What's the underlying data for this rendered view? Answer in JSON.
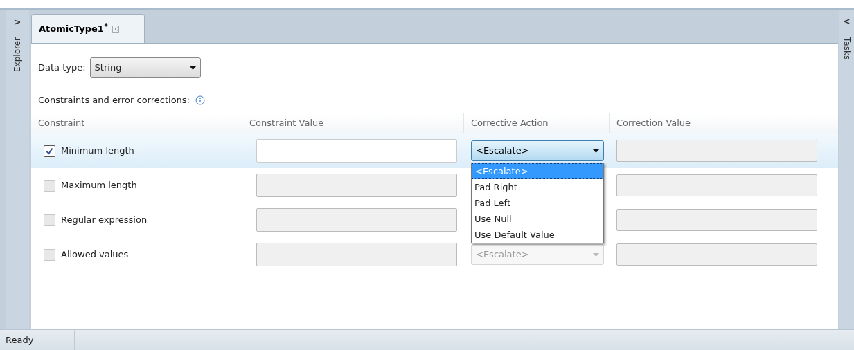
{
  "explorer_pane": {
    "toggle": ">",
    "label": "Explorer"
  },
  "tabs": [
    {
      "label": "AtomicType1",
      "modified_mark": "*",
      "selected": true
    }
  ],
  "data_type": {
    "label": "Data type:",
    "value": "String"
  },
  "section_label": "Constraints and error corrections:",
  "table": {
    "columns": [
      "Constraint",
      "Constraint Value",
      "Corrective Action",
      "Correction Value"
    ],
    "rows": [
      {
        "label": "Minimum length",
        "checked": true,
        "selected": true,
        "action": {
          "value": "<Escalate>",
          "disabled": false
        }
      },
      {
        "label": "Maximum length",
        "checked": false,
        "selected": false
      },
      {
        "label": "Regular expression",
        "checked": false,
        "selected": false
      },
      {
        "label": "Allowed values",
        "checked": false,
        "selected": false,
        "action": {
          "value": "<Escalate>",
          "disabled": true
        }
      }
    ]
  },
  "action_menu": {
    "options": [
      {
        "label": "<Escalate>",
        "selected": true
      },
      {
        "label": "Pad Right",
        "selected": false
      },
      {
        "label": "Pad Left",
        "selected": false
      },
      {
        "label": "Use Null",
        "selected": false
      },
      {
        "label": "Use Default Value",
        "selected": false
      }
    ]
  },
  "tasks_pane": {
    "toggle": "<",
    "label": "Tasks"
  },
  "status_bar": {
    "text": "Ready"
  }
}
